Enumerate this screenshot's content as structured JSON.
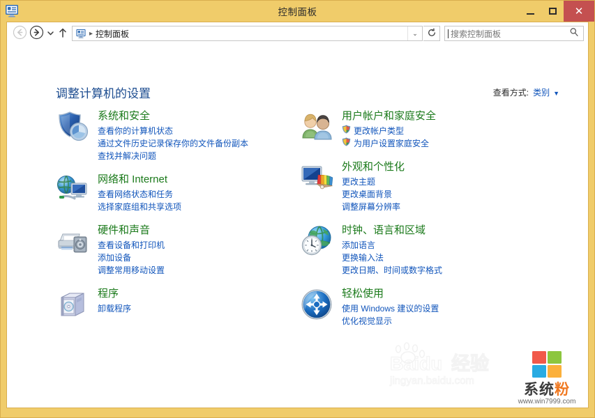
{
  "window": {
    "title": "控制面板",
    "icon": "control-panel-icon",
    "caption_buttons": {
      "minimize": "minimize-icon",
      "maximize": "maximize-icon",
      "close": "✕"
    },
    "colors": {
      "titlebar": "#f0cc6a",
      "frame_border": "#d9ae4f",
      "close_button": "#c45050",
      "heading_blue": "#1b4b8f",
      "category_green": "#1b7a1b",
      "link_blue": "#1155bb"
    }
  },
  "navbar": {
    "back": "back-arrow-icon",
    "forward": "forward-arrow-icon",
    "recent": "chevron-down-icon",
    "up": "up-arrow-icon",
    "address_icon": "control-panel-icon",
    "breadcrumb": "控制面板",
    "breadcrumb_separator": "▸",
    "address_dropdown": "⌄",
    "refresh": "refresh-icon",
    "search": {
      "placeholder": "搜索控制面板",
      "value": "",
      "icon": "search-icon"
    }
  },
  "content": {
    "heading": "调整计算机的设置",
    "view_by": {
      "label": "查看方式:",
      "value": "类别",
      "arrow": "▼"
    }
  },
  "categories": {
    "left": [
      {
        "icon": "shield-security-icon",
        "title": "系统和安全",
        "links": [
          {
            "text": "查看你的计算机状态",
            "shield": false
          },
          {
            "text": "通过文件历史记录保存你的文件备份副本",
            "shield": false
          },
          {
            "text": "查找并解决问题",
            "shield": false
          }
        ]
      },
      {
        "icon": "network-internet-icon",
        "title": "网络和 Internet",
        "links": [
          {
            "text": "查看网络状态和任务",
            "shield": false
          },
          {
            "text": "选择家庭组和共享选项",
            "shield": false
          }
        ]
      },
      {
        "icon": "hardware-sound-icon",
        "title": "硬件和声音",
        "links": [
          {
            "text": "查看设备和打印机",
            "shield": false
          },
          {
            "text": "添加设备",
            "shield": false
          },
          {
            "text": "调整常用移动设置",
            "shield": false
          }
        ]
      },
      {
        "icon": "programs-icon",
        "title": "程序",
        "links": [
          {
            "text": "卸载程序",
            "shield": false
          }
        ]
      }
    ],
    "right": [
      {
        "icon": "user-accounts-icon",
        "title": "用户帐户和家庭安全",
        "links": [
          {
            "text": "更改帐户类型",
            "shield": true
          },
          {
            "text": "为用户设置家庭安全",
            "shield": true
          }
        ]
      },
      {
        "icon": "appearance-personalization-icon",
        "title": "外观和个性化",
        "links": [
          {
            "text": "更改主题",
            "shield": false
          },
          {
            "text": "更改桌面背景",
            "shield": false
          },
          {
            "text": "调整屏幕分辨率",
            "shield": false
          }
        ]
      },
      {
        "icon": "clock-language-region-icon",
        "title": "时钟、语言和区域",
        "links": [
          {
            "text": "添加语言",
            "shield": false
          },
          {
            "text": "更换输入法",
            "shield": false
          },
          {
            "text": "更改日期、时间或数字格式",
            "shield": false
          }
        ]
      },
      {
        "icon": "ease-of-access-icon",
        "title": "轻松使用",
        "links": [
          {
            "text": "使用 Windows 建议的设置",
            "shield": false
          },
          {
            "text": "优化视觉显示",
            "shield": false
          }
        ]
      }
    ]
  },
  "watermarks": {
    "baidu": {
      "wordmark": "Baidu",
      "chinese": "经验",
      "url": "jingyan.baidu.com"
    },
    "brand": {
      "name_dark": "系统",
      "name_accent": "粉",
      "url": "www.win7999.com",
      "squares": [
        "#f1594a",
        "#8cc63e",
        "#29abe2",
        "#fbb03b"
      ]
    }
  }
}
